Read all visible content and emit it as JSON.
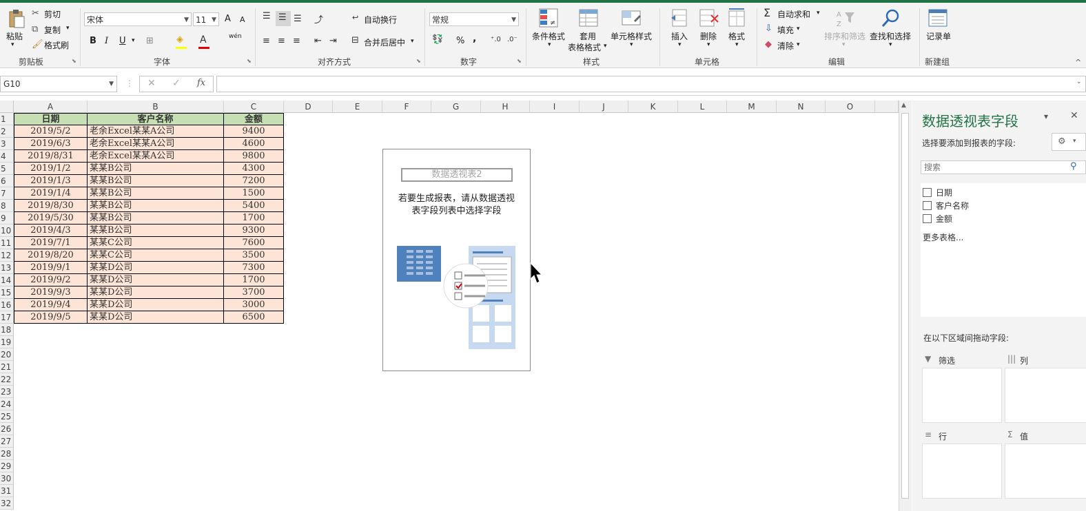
{
  "ribbon": {
    "clipboard": {
      "paste": "粘贴",
      "cut": "剪切",
      "copy": "复制",
      "format_painter": "格式刷",
      "group": "剪贴板"
    },
    "font": {
      "name": "宋体",
      "size": "11",
      "bold": "B",
      "italic": "I",
      "underline": "U",
      "grow": "A",
      "shrink": "A",
      "font_color_glyph": "A",
      "phonetic": "wén",
      "group": "字体"
    },
    "alignment": {
      "wrap": "自动换行",
      "merge": "合并后居中",
      "group": "对齐方式"
    },
    "number": {
      "format": "常规",
      "percent": "%",
      "comma": ",",
      "group": "数字"
    },
    "styles": {
      "conditional": "条件格式",
      "table_line1": "套用",
      "table_line2": "表格格式",
      "cell_styles": "单元格样式",
      "group": "样式"
    },
    "cells": {
      "insert": "插入",
      "delete": "删除",
      "format": "格式",
      "group": "单元格"
    },
    "editing": {
      "autosum": "自动求和",
      "fill": "填充",
      "clear": "清除",
      "sort": "排序和筛选",
      "find": "查找和选择",
      "group": "编辑"
    },
    "new_group": {
      "form": "记录单",
      "group": "新建组"
    }
  },
  "formula_bar": {
    "name_box": "G10",
    "cancel": "✕",
    "enter": "✓",
    "fx": "fx",
    "value": ""
  },
  "columns": [
    "A",
    "B",
    "C",
    "D",
    "E",
    "F",
    "G",
    "H",
    "I",
    "J",
    "K",
    "L",
    "M",
    "N",
    "O"
  ],
  "rows": [
    "1",
    "2",
    "3",
    "4",
    "5",
    "6",
    "7",
    "8",
    "9",
    "10",
    "11",
    "12",
    "13",
    "14",
    "15",
    "16",
    "17",
    "18",
    "19",
    "20",
    "21",
    "22",
    "23",
    "24",
    "25",
    "26",
    "27",
    "28",
    "29",
    "30",
    "31",
    "32"
  ],
  "table": {
    "headers": [
      "日期",
      "客户名称",
      "金额"
    ],
    "rows": [
      [
        "2019/5/2",
        "老余Excel某某A公司",
        "9400"
      ],
      [
        "2019/6/3",
        "老余Excel某某A公司",
        "4600"
      ],
      [
        "2019/8/31",
        "老余Excel某某A公司",
        "9800"
      ],
      [
        "2019/1/2",
        "某某B公司",
        "4300"
      ],
      [
        "2019/1/3",
        "某某B公司",
        "7200"
      ],
      [
        "2019/1/4",
        "某某B公司",
        "1500"
      ],
      [
        "2019/8/30",
        "某某B公司",
        "5400"
      ],
      [
        "2019/5/30",
        "某某B公司",
        "1700"
      ],
      [
        "2019/4/3",
        "某某B公司",
        "9300"
      ],
      [
        "2019/7/1",
        "某某C公司",
        "7600"
      ],
      [
        "2019/8/20",
        "某某C公司",
        "3500"
      ],
      [
        "2019/9/1",
        "某某D公司",
        "7300"
      ],
      [
        "2019/9/2",
        "某某D公司",
        "1700"
      ],
      [
        "2019/9/3",
        "某某D公司",
        "3700"
      ],
      [
        "2019/9/4",
        "某某D公司",
        "3000"
      ],
      [
        "2019/9/5",
        "某某D公司",
        "6500"
      ]
    ]
  },
  "pivot_placeholder": {
    "title": "数据透视表2",
    "instruction_line1": "若要生成报表，请从数据透视",
    "instruction_line2": "表字段列表中选择字段"
  },
  "pane": {
    "title": "数据透视表字段",
    "subtitle": "选择要添加到报表的字段:",
    "search_placeholder": "搜索",
    "fields": [
      "日期",
      "客户名称",
      "金额"
    ],
    "more_tables": "更多表格...",
    "drag_label": "在以下区域间拖动字段:",
    "areas": {
      "filter": "筛选",
      "columns": "列",
      "rows": "行",
      "values": "值"
    },
    "close": "✕",
    "menu": "▾"
  },
  "colors": {
    "header_fill": "#c6e0b4",
    "data_fill": "#fce4d6",
    "accent": "#217346",
    "pane_title": "#217346"
  }
}
